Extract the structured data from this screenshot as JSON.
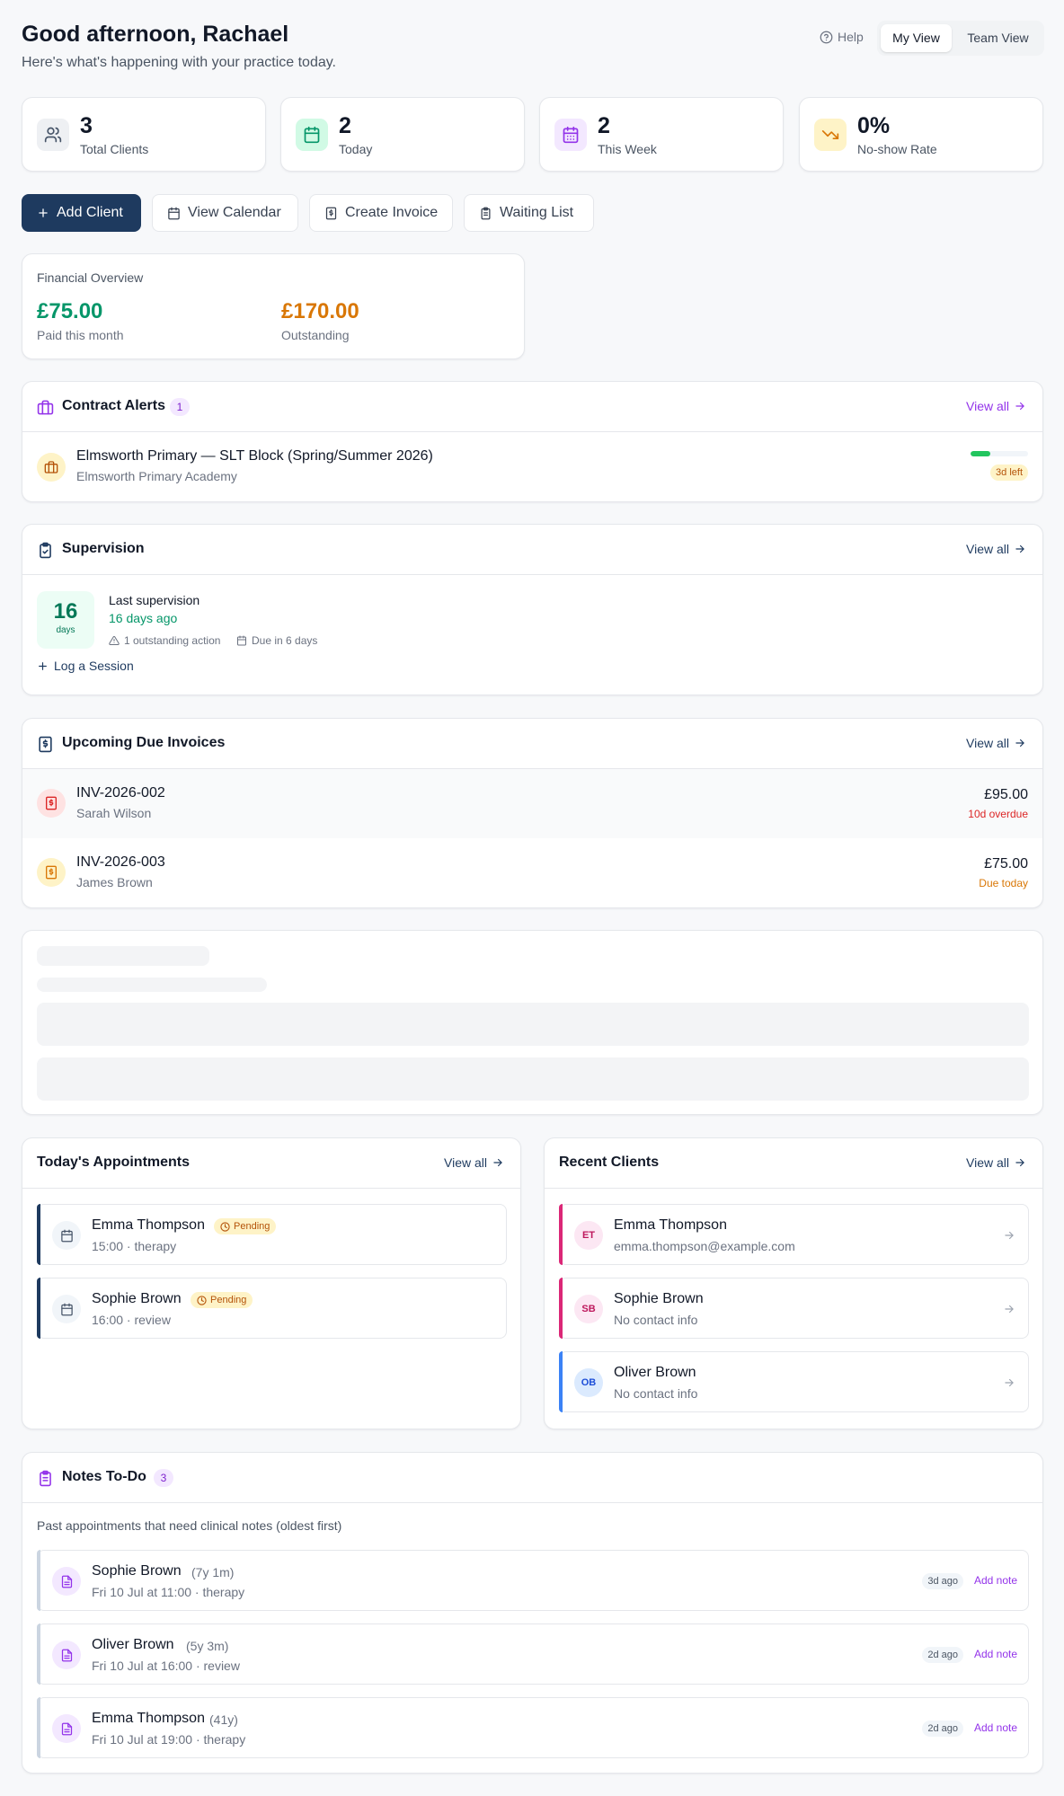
{
  "header": {
    "greeting": "Good afternoon, Rachael",
    "subtitle": "Here's what's happening with your practice today.",
    "help_label": "Help",
    "views": [
      "My View",
      "Team View"
    ],
    "active_view": "My View"
  },
  "stats": [
    {
      "value": "3",
      "label": "Total Clients",
      "icon": "users-icon"
    },
    {
      "value": "2",
      "label": "Today",
      "icon": "calendar-icon"
    },
    {
      "value": "2",
      "label": "This Week",
      "icon": "calendar-days-icon"
    },
    {
      "value": "0%",
      "label": "No-show Rate",
      "icon": "trending-down-icon"
    }
  ],
  "actions": {
    "add_client": "Add Client",
    "view_calendar": "View Calendar",
    "create_invoice": "Create Invoice",
    "waiting_list": "Waiting List"
  },
  "financial": {
    "title": "Financial Overview",
    "paid_amount": "£75.00",
    "paid_label": "Paid this month",
    "outstanding_amount": "£170.00",
    "outstanding_label": "Outstanding"
  },
  "contract_alerts": {
    "title": "Contract Alerts",
    "count": "1",
    "view_all": "View all",
    "items": [
      {
        "title": "Elmsworth Primary — SLT Block (Spring/Summer 2026)",
        "subtitle": "Elmsworth Primary Academy",
        "days_left": "3d left",
        "progress": 0.35
      }
    ]
  },
  "supervision": {
    "title": "Supervision",
    "view_all": "View all",
    "days": "16",
    "days_unit": "days",
    "last_label": "Last supervision",
    "last_value": "16 days ago",
    "outstanding": "1 outstanding action",
    "due": "Due in 6 days",
    "log_label": "Log a Session"
  },
  "invoices": {
    "title": "Upcoming Due Invoices",
    "view_all": "View all",
    "items": [
      {
        "number": "INV-2026-002",
        "client": "Sarah Wilson",
        "amount": "£95.00",
        "status": "10d overdue"
      },
      {
        "number": "INV-2026-003",
        "client": "James Brown",
        "amount": "£75.00",
        "status": "Due today"
      }
    ]
  },
  "appointments": {
    "title": "Today's Appointments",
    "view_all": "View all",
    "items": [
      {
        "name": "Emma Thompson",
        "badge": "Pending",
        "detail": "15:00 · therapy"
      },
      {
        "name": "Sophie Brown",
        "badge": "Pending",
        "detail": "16:00 · review"
      }
    ]
  },
  "recent_clients": {
    "title": "Recent Clients",
    "view_all": "View all",
    "items": [
      {
        "initials": "ET",
        "name": "Emma Thompson",
        "contact": "emma.thompson@example.com",
        "color": "#db2777"
      },
      {
        "initials": "SB",
        "name": "Sophie Brown",
        "contact": "No contact info",
        "color": "#db2777"
      },
      {
        "initials": "OB",
        "name": "Oliver Brown",
        "contact": "No contact info",
        "color": "#3b82f6"
      }
    ]
  },
  "notes": {
    "title": "Notes To-Do",
    "count": "3",
    "description": "Past appointments that need clinical notes (oldest first)",
    "add_label": "Add note",
    "items": [
      {
        "name": "Sophie Brown",
        "age": "(7y 1m)",
        "detail": "Fri 10 Jul at 11:00 · therapy",
        "ago": "3d ago"
      },
      {
        "name": "Oliver Brown",
        "age": "(5y 3m)",
        "detail": "Fri 10 Jul at 16:00 · review",
        "ago": "2d ago"
      },
      {
        "name": "Emma Thompson",
        "age": "(41y)",
        "detail": "Fri 10 Jul at 19:00 · therapy",
        "ago": "2d ago"
      }
    ]
  },
  "colors": {
    "primary": "#1e3a5f",
    "paid": "#059669",
    "outstanding": "#d97706",
    "accent_purple": "#9333ea",
    "overdue": "#dc2626"
  }
}
